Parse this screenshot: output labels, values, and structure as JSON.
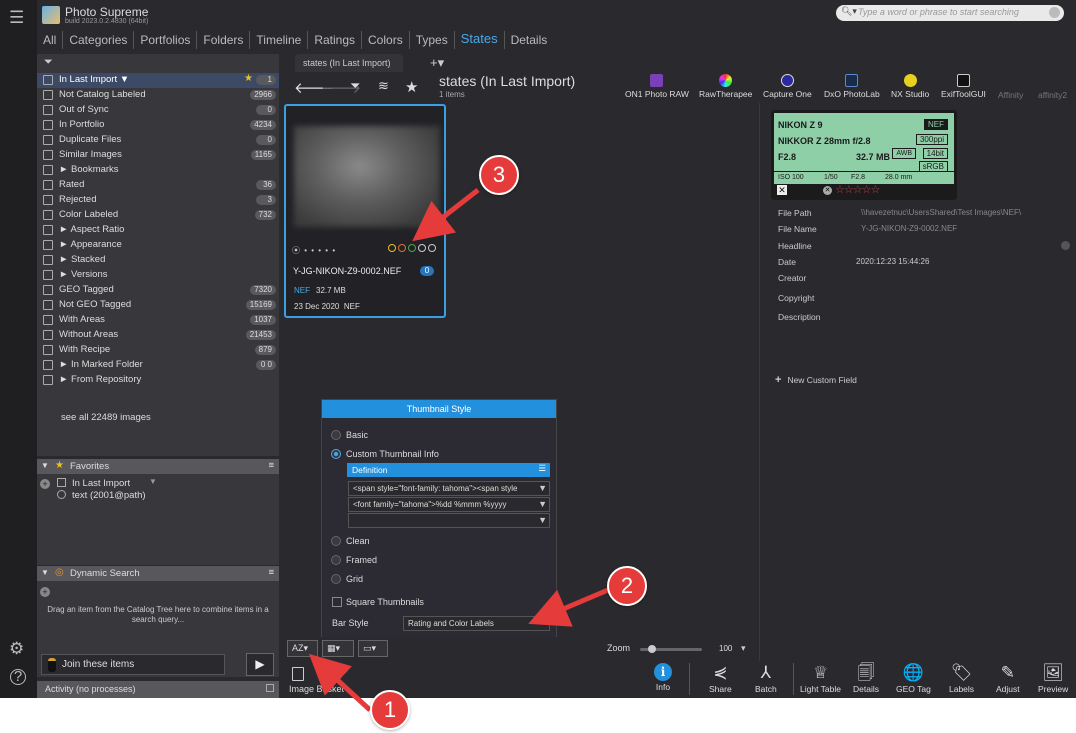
{
  "app": {
    "title": "Photo Supreme",
    "build": "build 2023.0.2.4830 (64bit)"
  },
  "search": {
    "placeholder": "Type a word or phrase to start searching"
  },
  "nav_tabs": [
    "All",
    "Categories",
    "Portfolios",
    "Folders",
    "Timeline",
    "Ratings",
    "Colors",
    "Types",
    "States",
    "Details"
  ],
  "active_nav_tab": "States",
  "catalog": {
    "rows": [
      {
        "label": "In Last Import ▼",
        "count": "1",
        "selected": true,
        "starred": true
      },
      {
        "label": "Not Catalog Labeled",
        "count": "2966"
      },
      {
        "label": "Out of Sync",
        "count": "0"
      },
      {
        "label": "In Portfolio",
        "count": "4234"
      },
      {
        "label": "Duplicate Files",
        "count": "0"
      },
      {
        "label": "Similar Images",
        "count": "1165"
      },
      {
        "label": "► Bookmarks",
        "count": ""
      },
      {
        "label": "Rated",
        "count": "36"
      },
      {
        "label": "Rejected",
        "count": "3"
      },
      {
        "label": "Color Labeled",
        "count": "732"
      },
      {
        "label": "► Aspect Ratio",
        "count": ""
      },
      {
        "label": "► Appearance",
        "count": ""
      },
      {
        "label": "► Stacked",
        "count": ""
      },
      {
        "label": "► Versions",
        "count": ""
      },
      {
        "label": "GEO Tagged",
        "count": "7320"
      },
      {
        "label": "Not GEO Tagged",
        "count": "15169"
      },
      {
        "label": "With Areas",
        "count": "1037"
      },
      {
        "label": "Without Areas",
        "count": "21453"
      },
      {
        "label": "With Recipe",
        "count": "879"
      },
      {
        "label": "► In Marked Folder",
        "count": "0 0"
      },
      {
        "label": "► From Repository",
        "count": ""
      }
    ],
    "see_all": "see all 22489 images"
  },
  "favorites": {
    "title": "Favorites",
    "items": [
      "In Last Import",
      "text (2001@path)"
    ]
  },
  "dynamic_search": {
    "title": "Dynamic Search",
    "hint_line1": "Drag an item from the Catalog Tree here to combine items in a",
    "hint_line2": "search query..."
  },
  "join": {
    "label": "Join these items"
  },
  "activity": {
    "label": "Activity (no processes)"
  },
  "content": {
    "tab_label": "states (In Last Import)",
    "title": "states (In Last Import)",
    "items": "1 items"
  },
  "ext_tools": [
    "ON1 Photo RAW",
    "RawTherapee",
    "Capture One",
    "DxO PhotoLab",
    "NX Studio",
    "ExifToolGUI",
    "Affinity",
    "affinity2"
  ],
  "thumbnail": {
    "filename": "Y-JG-NIKON-Z9-0002.NEF",
    "badge": "0",
    "ext": "NEF",
    "size": "32.7 MB",
    "date": "23 Dec 2020",
    "date_ext": "NEF",
    "dots": "⦿ • • • • •",
    "ring_colors": [
      "#e8c020",
      "#e07030",
      "#4aa84a",
      "#cccccc",
      "#cccccc"
    ]
  },
  "popup": {
    "title": "Thumbnail Style",
    "opt_basic": "Basic",
    "opt_custom": "Custom Thumbnail Info",
    "definition": "Definition",
    "def_row1": "<span style=\"font-family: tahoma\"><span style",
    "def_row2": "<font family=\"tahoma\">%dd %mmm %yyyy",
    "opt_clean": "Clean",
    "opt_framed": "Framed",
    "opt_grid": "Grid",
    "square": "Square Thumbnails",
    "bar_style_label": "Bar Style",
    "bar_style_value": "Rating and Color Labels"
  },
  "bottom": {
    "sort": "AZ",
    "zoom_label": "Zoom",
    "zoom_value": "100",
    "zoom_fraction": 0.2
  },
  "image_basket": {
    "label": "Image Basket"
  },
  "dock": [
    "Info",
    "Share",
    "Batch",
    "Light Table",
    "Details",
    "GEO Tag",
    "Labels",
    "Adjust",
    "Preview"
  ],
  "lcd": {
    "camera": "NIKON Z 9",
    "lens": "NIKKOR Z 28mm f/2.8",
    "aperture": "F2.8",
    "size": "32.7 MB",
    "badge_nef": "NEF",
    "badge_ppi": "300ppi",
    "badge_bit": "14bit",
    "badge_rgb": "sRGB",
    "badge_awb": "AWB",
    "iso": "ISO 100",
    "shutter": "1/50",
    "fstop": "F2.8",
    "focal": "28.0 mm"
  },
  "details": {
    "file_path_label": "File Path",
    "file_path_value": "\\\\havezetnuc\\UsersShared\\Test Images\\NEF\\",
    "file_name_label": "File Name",
    "file_name_value": "Y-JG-NIKON-Z9-0002.NEF",
    "headline_label": "Headline",
    "date_label": "Date",
    "date_value": "2020:12:23 15:44:26",
    "creator_label": "Creator",
    "copyright_label": "Copyright",
    "description_label": "Description",
    "new_field": "New Custom Field"
  },
  "callouts": [
    "1",
    "2",
    "3"
  ],
  "colors": {
    "accent": "#2390de",
    "callout": "#e53b3b"
  }
}
